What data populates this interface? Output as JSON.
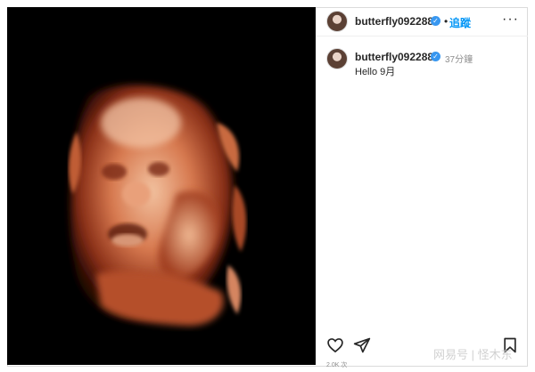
{
  "post": {
    "username": "butterfly092288",
    "verified_symbol": "✓",
    "dot": "•",
    "follow_label": "追蹤",
    "more_symbol": "···",
    "caption": "Hello 9月",
    "time": "37分鐘",
    "likes_text": "2.0K 次",
    "watermark": "网易号 | 怪木东"
  },
  "icons": {
    "heart": "heart-icon",
    "share": "share-icon",
    "save": "bookmark-icon",
    "verified": "verified-badge-icon"
  },
  "colors": {
    "accent": "#0095f6",
    "verified": "#3897f0",
    "media_background": "#000000",
    "flesh_tone": "#c8623f"
  }
}
